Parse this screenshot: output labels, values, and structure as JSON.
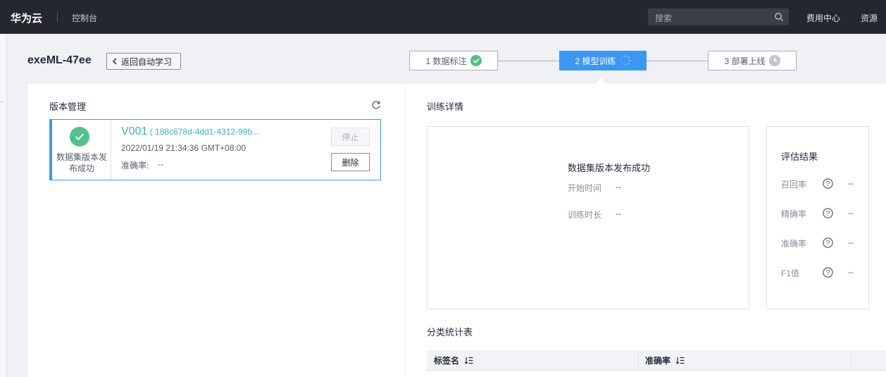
{
  "topbar": {
    "brand": "华为云",
    "console": "控制台",
    "search_placeholder": "搜索",
    "fee_center": "费用中心",
    "resources": "资源"
  },
  "header": {
    "title": "exeML-47ee",
    "back_label": "返回自动学习"
  },
  "steps": [
    {
      "label": "1 数据标注",
      "state": "done"
    },
    {
      "label": "2 模型训练",
      "state": "active"
    },
    {
      "label": "3 部署上线",
      "state": "pending"
    }
  ],
  "version_panel": {
    "title": "版本管理",
    "card": {
      "status_text": "数据集版本发布成功",
      "name": "V001",
      "id": " ( 188c678d-4dd1-4312-99b...",
      "date": "2022/01/19 21:34:36 GMT+08:00",
      "accuracy_label": "准确率:",
      "accuracy_value": "--",
      "stop_label": "停止",
      "delete_label": "删除"
    }
  },
  "training": {
    "title": "训练详情",
    "status": "数据集版本发布成功",
    "start_label": "开始时间",
    "start_value": "--",
    "duration_label": "训练时长",
    "duration_value": "--"
  },
  "evaluation": {
    "title": "评估结果",
    "rows": [
      {
        "label": "召回率",
        "value": "--"
      },
      {
        "label": "精确率",
        "value": "--"
      },
      {
        "label": "准确率",
        "value": "--"
      },
      {
        "label": "F1值",
        "value": "--"
      }
    ]
  },
  "stats_table": {
    "title": "分类统计表",
    "columns": [
      "标签名",
      "准确率"
    ]
  },
  "colors": {
    "accent": "#3b97f4",
    "success": "#4ec28a",
    "topbar": "#24272e"
  }
}
